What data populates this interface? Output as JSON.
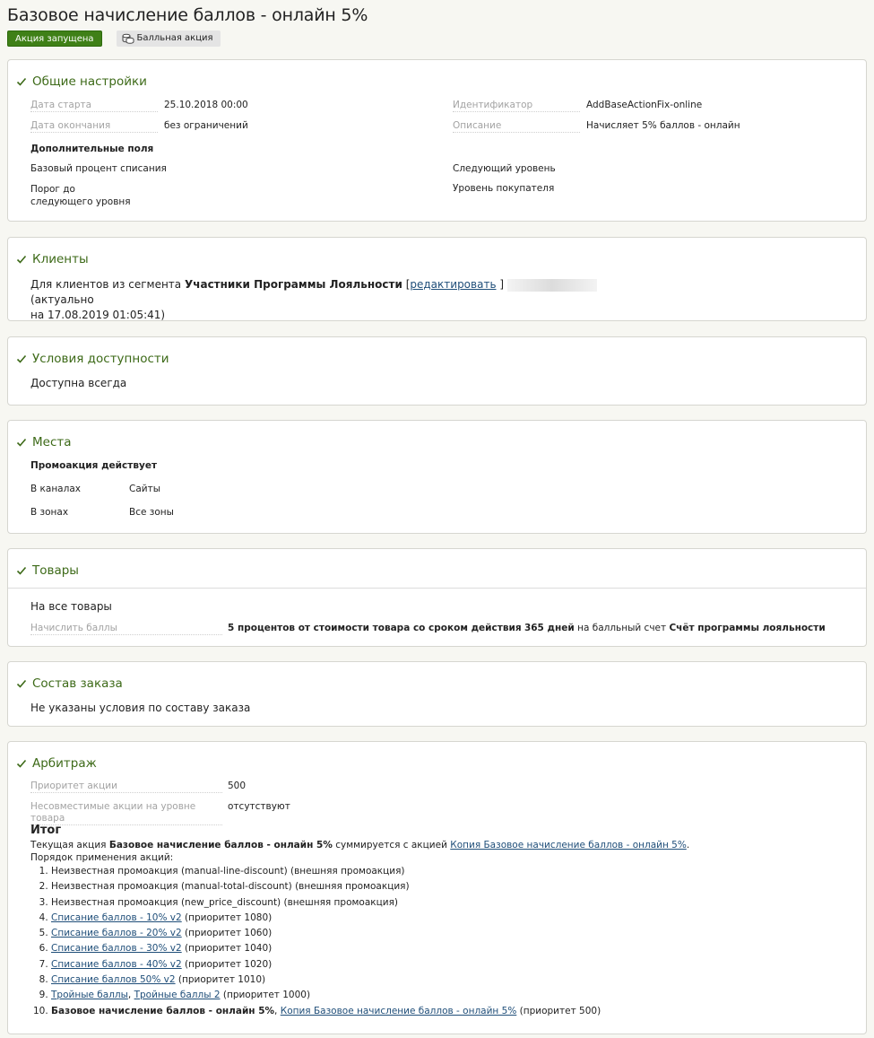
{
  "page": {
    "title": "Базовое начисление баллов - онлайн 5%",
    "status_badge": "Акция запущена",
    "type_badge": "Балльная акция"
  },
  "colors": {
    "accent_green": "#3f8017",
    "heading_green": "#3d6a18",
    "link_blue": "#1f4e79"
  },
  "general": {
    "heading": "Общие настройки",
    "start_label": "Дата старта",
    "start_value": "25.10.2018 00:00",
    "end_label": "Дата окончания",
    "end_value": "без ограничений",
    "id_label": "Идентификатор",
    "id_value": "AddBaseActionFix-online",
    "desc_label": "Описание",
    "desc_value": "Начисляет 5% баллов - онлайн",
    "extra_fields_title": "Дополнительные поля",
    "base_percent_label": "Базовый процент списания",
    "threshold_label": "Порог до следующего уровня",
    "next_level_label": "Следующий уровень",
    "customer_level_label": "Уровень покупателя"
  },
  "clients": {
    "heading": "Клиенты",
    "prefix": "Для клиентов из сегмента",
    "segment": "Участники Программы Лояльности",
    "bracket_open": "[",
    "edit_link": "редактировать",
    "bracket_close": "]",
    "actual_text": "(актуально",
    "actual_date": "на 17.08.2019 01:05:41)"
  },
  "availability": {
    "heading": "Условия доступности",
    "text": "Доступна всегда"
  },
  "places": {
    "heading": "Места",
    "subtitle": "Промоакция действует",
    "channels_label": "В каналах",
    "channels_value": "Сайты",
    "zones_label": "В зонах",
    "zones_value": "Все зоны"
  },
  "products": {
    "heading": "Товары",
    "all_products": "На все товары",
    "accrue_label": "Начислить баллы",
    "accrue_part1": "5 процентов от стоимости товара со сроком действия",
    "accrue_days": "365 дней",
    "accrue_part2": "на балльный счет",
    "accrue_account": "Счёт программы лояльности"
  },
  "order": {
    "heading": "Состав заказа",
    "text": "Не указаны условия по составу заказа"
  },
  "arbitrage": {
    "heading": "Арбитраж",
    "priority_label": "Приоритет акции",
    "priority_value": "500",
    "incompat_label": "Несовместимые акции на уровне товара",
    "incompat_value": "отсутствуют",
    "summary_title": "Итог",
    "summary_prefix": "Текущая акция",
    "summary_action": "Базовое начисление баллов - онлайн 5%",
    "summary_mid": "суммируется с акцией",
    "summary_link": "Копия Базовое начисление баллов - онлайн 5%",
    "summary_end": ".",
    "order_title": "Порядок применения акций:",
    "items": [
      {
        "link": "",
        "text": "Неизвестная промоакция (manual-line-discount) (внешняя промоакция)"
      },
      {
        "link": "",
        "text": "Неизвестная промоакция (manual-total-discount) (внешняя промоакция)"
      },
      {
        "link": "",
        "text": "Неизвестная промоакция (new_price_discount) (внешняя промоакция)"
      },
      {
        "link": "Списание баллов - 10% v2",
        "text": " (приоритет 1080)"
      },
      {
        "link": "Списание баллов - 20% v2",
        "text": " (приоритет 1060)"
      },
      {
        "link": "Списание баллов - 30% v2",
        "text": " (приоритет 1040)"
      },
      {
        "link": "Списание баллов - 40% v2",
        "text": " (приоритет 1020)"
      },
      {
        "link": "Списание баллов 50% v2",
        "text": " (приоритет 1010)"
      }
    ],
    "item9_link1": "Тройные баллы",
    "item9_sep": ", ",
    "item9_link2": "Тройные баллы 2",
    "item9_text": " (приоритет 1000)",
    "item10_bold": "Базовое начисление баллов - онлайн 5%",
    "item10_sep": ", ",
    "item10_link": "Копия Базовое начисление баллов - онлайн 5%",
    "item10_text": " (приоритет 500)"
  }
}
